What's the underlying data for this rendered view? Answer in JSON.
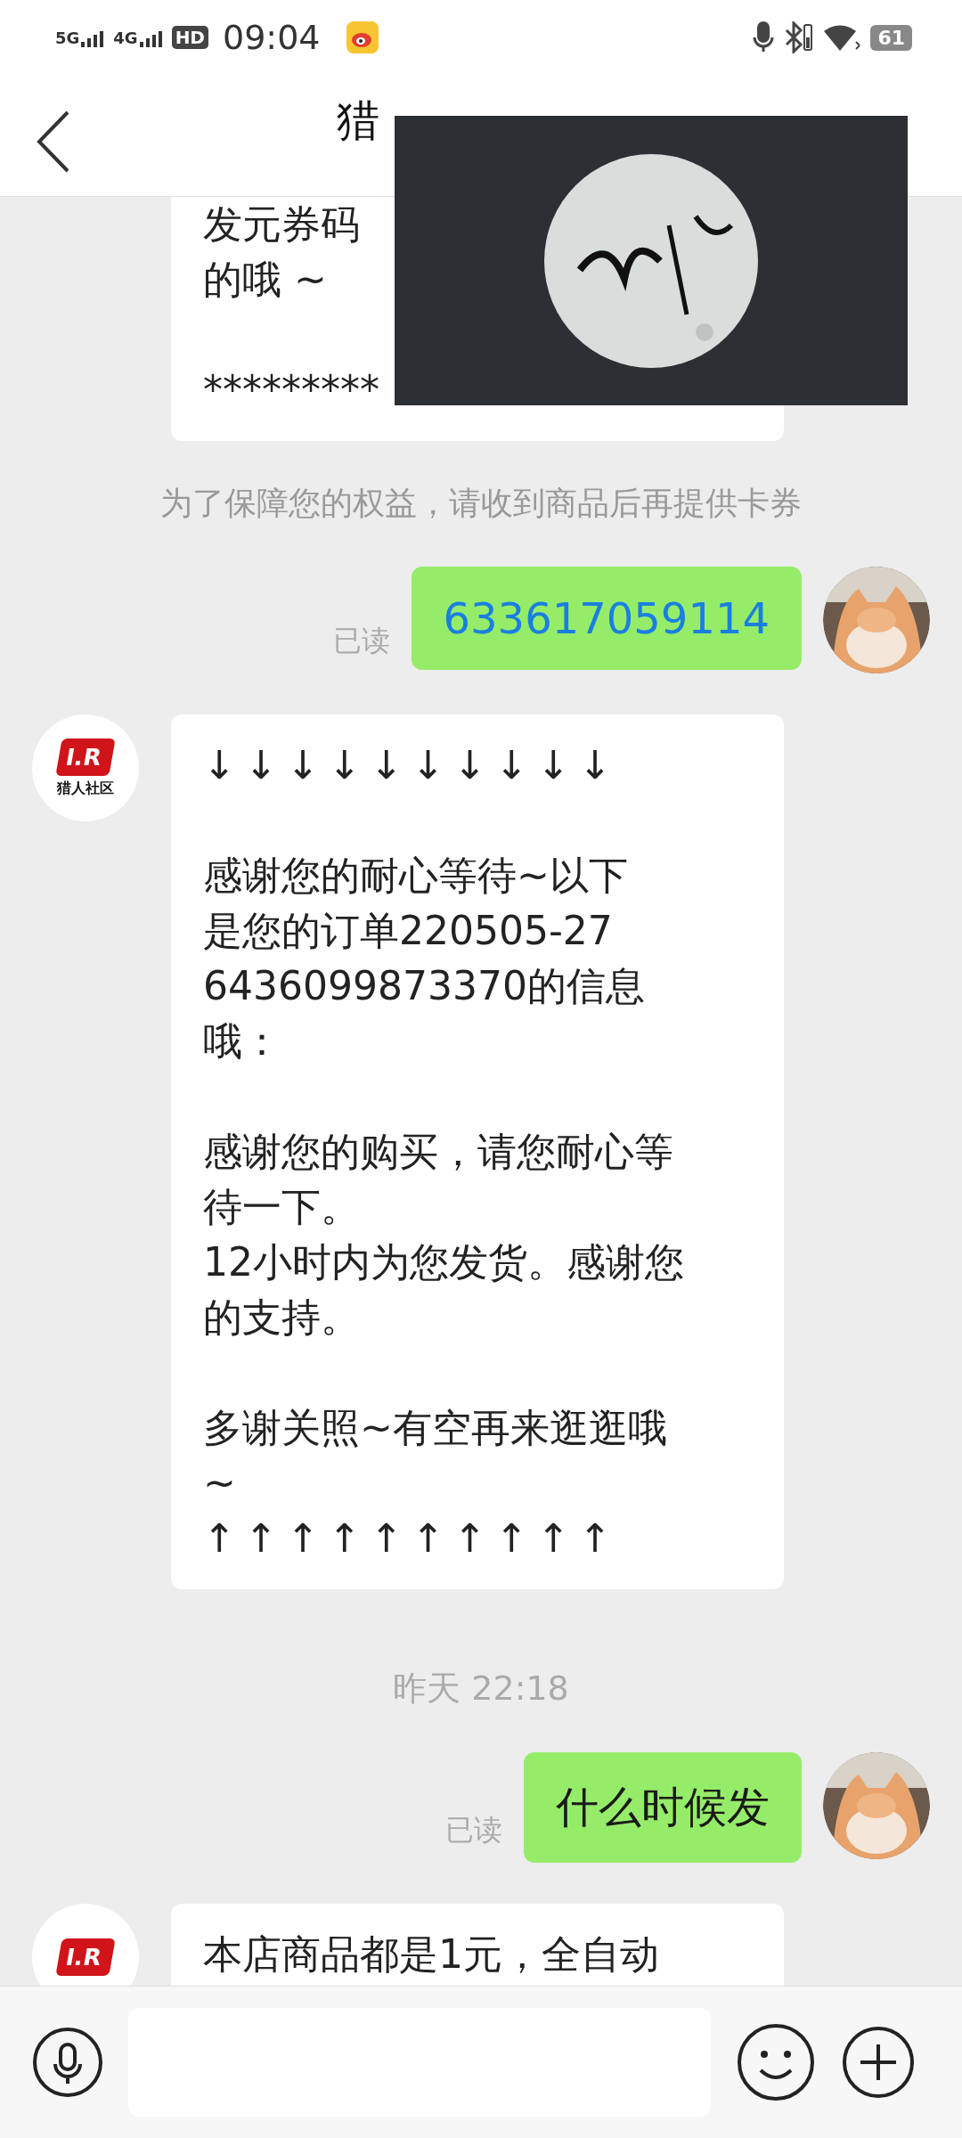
{
  "status_bar": {
    "network_1": "5G",
    "network_2": "4G",
    "hd": "HD",
    "time": "09:04",
    "battery": "61"
  },
  "header": {
    "title": "猎"
  },
  "messages": [
    {
      "kind": "incoming",
      "paragraphs": [
        [
          "发元券码",
          "的哦 ~"
        ],
        [
          "*********"
        ]
      ]
    },
    {
      "kind": "notice",
      "text": "为了保障您的权益，请收到商品后再提供卡券"
    },
    {
      "kind": "outgoing",
      "text": "633617059114",
      "link": true,
      "read_label": "已读"
    },
    {
      "kind": "incoming",
      "avatar_logo": "I.R",
      "avatar_caption": "猎人社区",
      "paragraphs": [
        [
          "↓↓↓↓↓↓↓↓↓↓"
        ],
        [
          "感谢您的耐心等待~以下",
          "是您的订单220505-27",
          "6436099873370的信息",
          "哦："
        ],
        [
          "感谢您的购买，请您耐心等",
          "待一下。",
          "12小时内为您发货。感谢您",
          "的支持。"
        ],
        [
          "多谢关照~有空再来逛逛哦",
          "~",
          "↑↑↑↑↑↑↑↑↑↑"
        ]
      ]
    },
    {
      "kind": "time",
      "text": "昨天 22:18"
    },
    {
      "kind": "outgoing",
      "text": "什么时候发",
      "link": false,
      "read_label": "已读"
    },
    {
      "kind": "incoming",
      "avatar_logo": "I.R",
      "paragraphs": [
        [
          "本店商品都是1元，全自动"
        ]
      ]
    }
  ]
}
